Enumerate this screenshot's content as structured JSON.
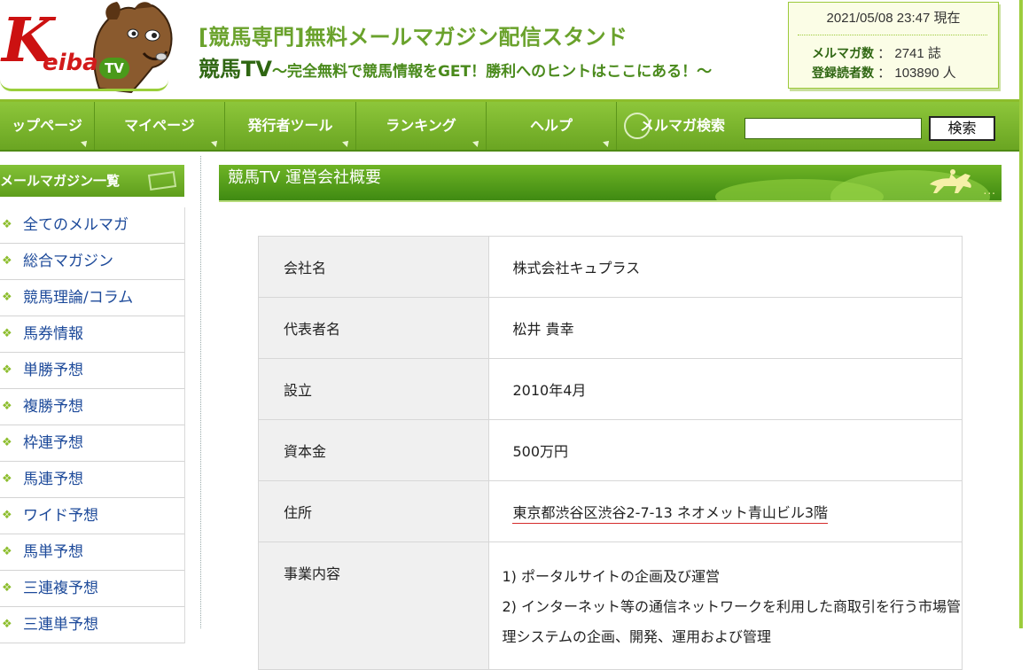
{
  "header": {
    "logo_k": "K",
    "logo_eiba": "eiba",
    "logo_tv": "TV",
    "tagline1": "[競馬専門]無料メールマガジン配信スタンド",
    "brand": "競馬TV",
    "tagline2": "〜完全無料で競馬情報をGET！勝利へのヒントはここにある！〜"
  },
  "stats": {
    "datetime": "2021/05/08 23:47  現在",
    "mag_label": "メルマガ数",
    "mag_count": "2741 誌",
    "reader_label": "登録読者数",
    "reader_count": "103890 人",
    "colon": "："
  },
  "nav": {
    "items": [
      "ップページ",
      "マイページ",
      "発行者ツール",
      "ランキング",
      "ヘルプ"
    ],
    "search_label": "メルマガ検索",
    "search_value": "",
    "search_button": "検索"
  },
  "sidebar": {
    "title": "メールマガジン一覧",
    "bullet": "❖",
    "items": [
      "全てのメルマガ",
      "総合マガジン",
      "競馬理論/コラム",
      "馬券情報",
      "単勝予想",
      "複勝予想",
      "枠連予想",
      "馬連予想",
      "ワイド予想",
      "馬単予想",
      "三連複予想",
      "三連単予想"
    ]
  },
  "page": {
    "title": "競馬TV 運営会社概要",
    "title_dots": "...",
    "rows": [
      {
        "key": "会社名",
        "value": "株式会社キュプラス"
      },
      {
        "key": "代表者名",
        "value": "松井 貴幸"
      },
      {
        "key": "設立",
        "value": "2010年4月"
      },
      {
        "key": "資本金",
        "value": "500万円"
      },
      {
        "key": "住所",
        "value": "東京都渋谷区渋谷2-7-13 ネオメット青山ビル3階"
      }
    ],
    "business_key": "事業内容",
    "business_lines": [
      "1) ポータルサイトの企画及び運営",
      "2) インターネット等の通信ネットワークを利用した商取引を行う市場管",
      "理システムの企画、開発、運用および管理"
    ]
  },
  "colors": {
    "brand_green": "#6aa522",
    "dark_green": "#2f6612",
    "link_blue": "#1d4a9a",
    "logo_red": "#cc1111"
  }
}
